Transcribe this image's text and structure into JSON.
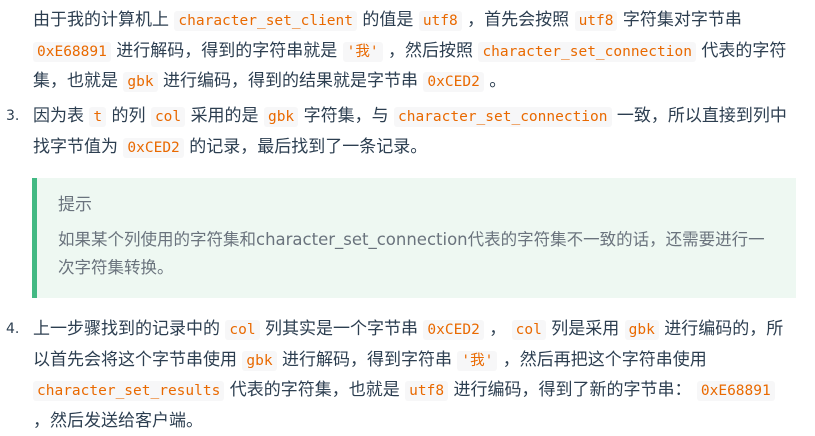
{
  "item2": {
    "t1": "由于我的计算机上",
    "c1": "character_set_client",
    "t2": "的值是",
    "c2": "utf8",
    "t3": "，首先会按照",
    "c3": "utf8",
    "t4": "字符集对字节串",
    "c4": "0xE68891",
    "t5": "进行解码，得到的字符串就是",
    "c5": "'我'",
    "t6": "，然后按照",
    "c6": "character_set_connection",
    "t7": "代表的字符集，也就是",
    "c7": "gbk",
    "t8": "进行编码，得到的结果就是字节串",
    "c8": "0xCED2",
    "t9": "。"
  },
  "item3": {
    "marker": "3.",
    "t1": "因为表",
    "c1": "t",
    "t2": "的列",
    "c2": "col",
    "t3": "采用的是",
    "c3": "gbk",
    "t4": "字符集，与",
    "c4": "character_set_connection",
    "t5": "一致，所以直接到列中找字节值为",
    "c5": "0xCED2",
    "t6": "的记录，最后找到了一条记录。"
  },
  "tip": {
    "title": "提示",
    "body": "如果某个列使用的字符集和character_set_connection代表的字符集不一致的话，还需要进行一次字符集转换。"
  },
  "item4": {
    "marker": "4.",
    "t1": "上一步骤找到的记录中的",
    "c1": "col",
    "t2": "列其实是一个字节串",
    "c2": "0xCED2",
    "t3": "，",
    "c3": "col",
    "t4": "列是采用",
    "c4": "gbk",
    "t5": "进行编码的，所以首先会将这个字节串使用",
    "c5": "gbk",
    "t6": "进行解码，得到字符串",
    "c6": "'我'",
    "t7": "，然后再把这个字符串使用",
    "c7": "character_set_results",
    "t8": "代表的字符集，也就是",
    "c8": "utf8",
    "t9": "进行编码，得到了新的字节串：",
    "c9": "0xE68891",
    "t10": "，然后发送给客户端。"
  }
}
